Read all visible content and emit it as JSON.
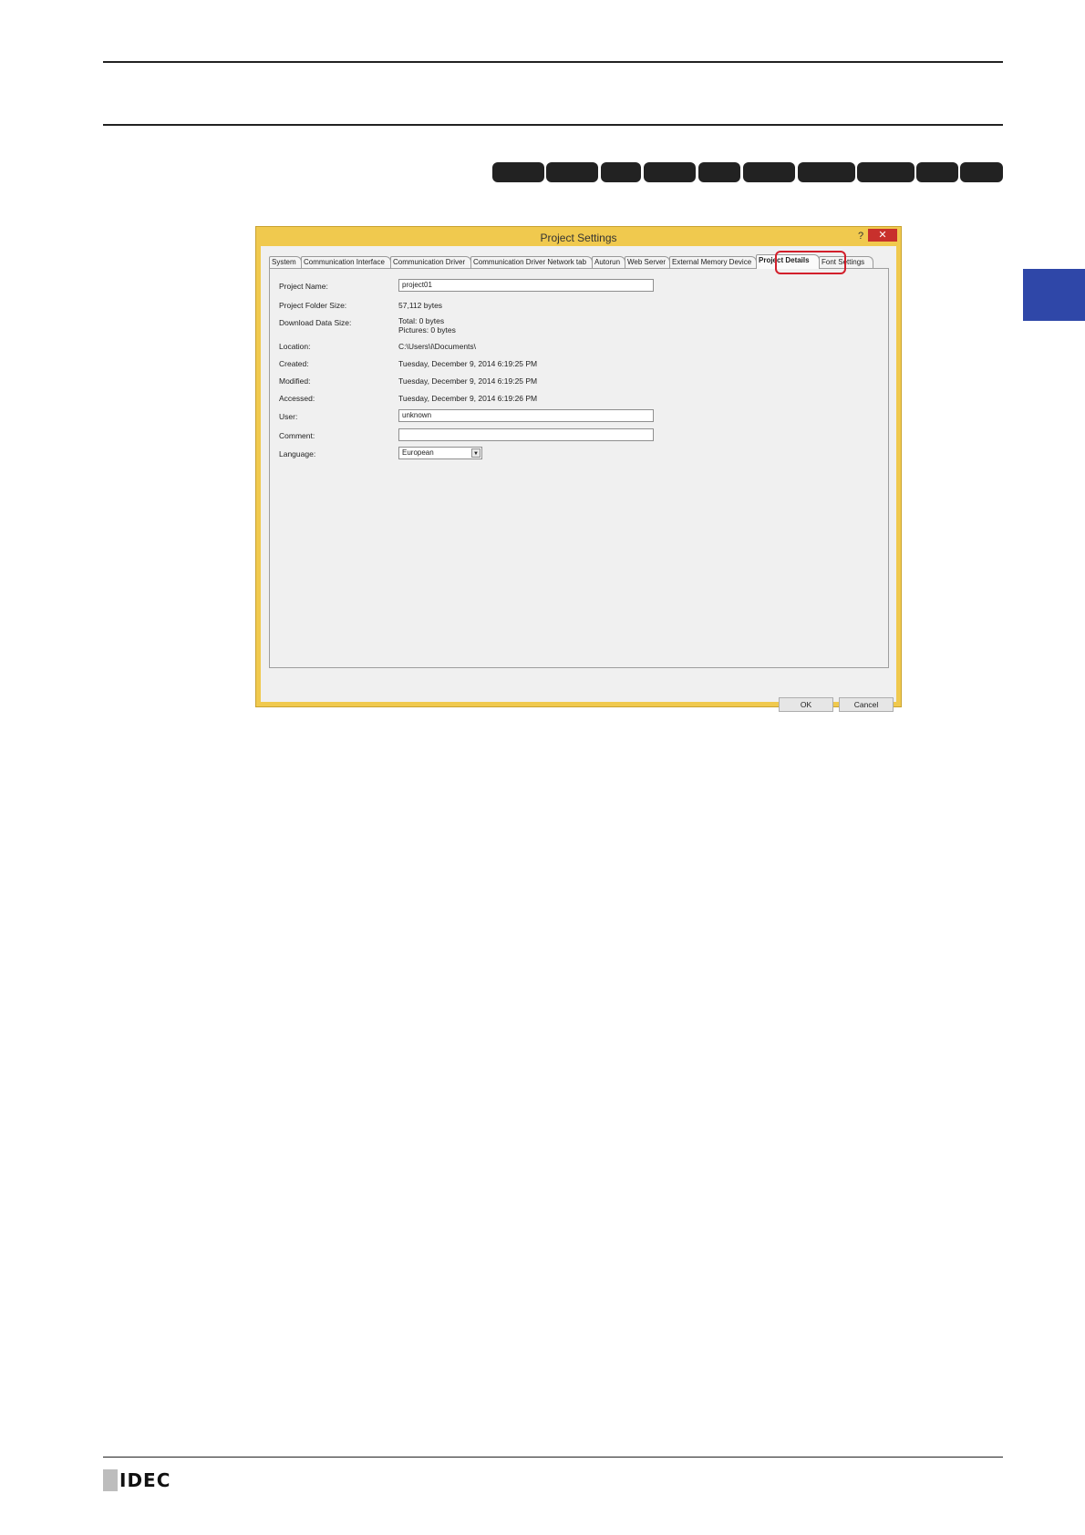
{
  "dialog": {
    "title": "Project Settings",
    "help": "?",
    "close": "✕",
    "tabs": [
      {
        "label": "System",
        "active": false
      },
      {
        "label": "Communication Interface",
        "active": false
      },
      {
        "label": "Communication Driver",
        "active": false
      },
      {
        "label": "Communication Driver Network tab",
        "active": false
      },
      {
        "label": "Autorun",
        "active": false
      },
      {
        "label": "Web Server",
        "active": false
      },
      {
        "label": "External Memory Device",
        "active": false
      },
      {
        "label": "Project Details",
        "active": true
      },
      {
        "label": "Font Settings",
        "active": false
      }
    ],
    "fields": {
      "project_name_label": "Project Name:",
      "project_name_value": "project01",
      "folder_size_label": "Project Folder Size:",
      "folder_size_value": "57,112 bytes",
      "download_size_label": "Download Data Size:",
      "download_total": "Total: 0 bytes",
      "download_pictures": "Pictures: 0 bytes",
      "location_label": "Location:",
      "location_value": "C:\\Users\\i\\Documents\\",
      "created_label": "Created:",
      "created_value": "Tuesday, December 9, 2014 6:19:25 PM",
      "modified_label": "Modified:",
      "modified_value": "Tuesday, December 9, 2014 6:19:25 PM",
      "accessed_label": "Accessed:",
      "accessed_value": "Tuesday, December 9, 2014 6:19:26 PM",
      "user_label": "User:",
      "user_value": "unknown",
      "comment_label": "Comment:",
      "comment_value": "",
      "language_label": "Language:",
      "language_value": "European"
    },
    "buttons": {
      "ok": "OK",
      "cancel": "Cancel"
    }
  },
  "footer": {
    "logo": "IDEC"
  },
  "colors": {
    "dialog_frame": "#f0c94e",
    "close_button": "#c8302c",
    "highlight": "#d21f2b",
    "side_tab": "#2f47a8"
  }
}
